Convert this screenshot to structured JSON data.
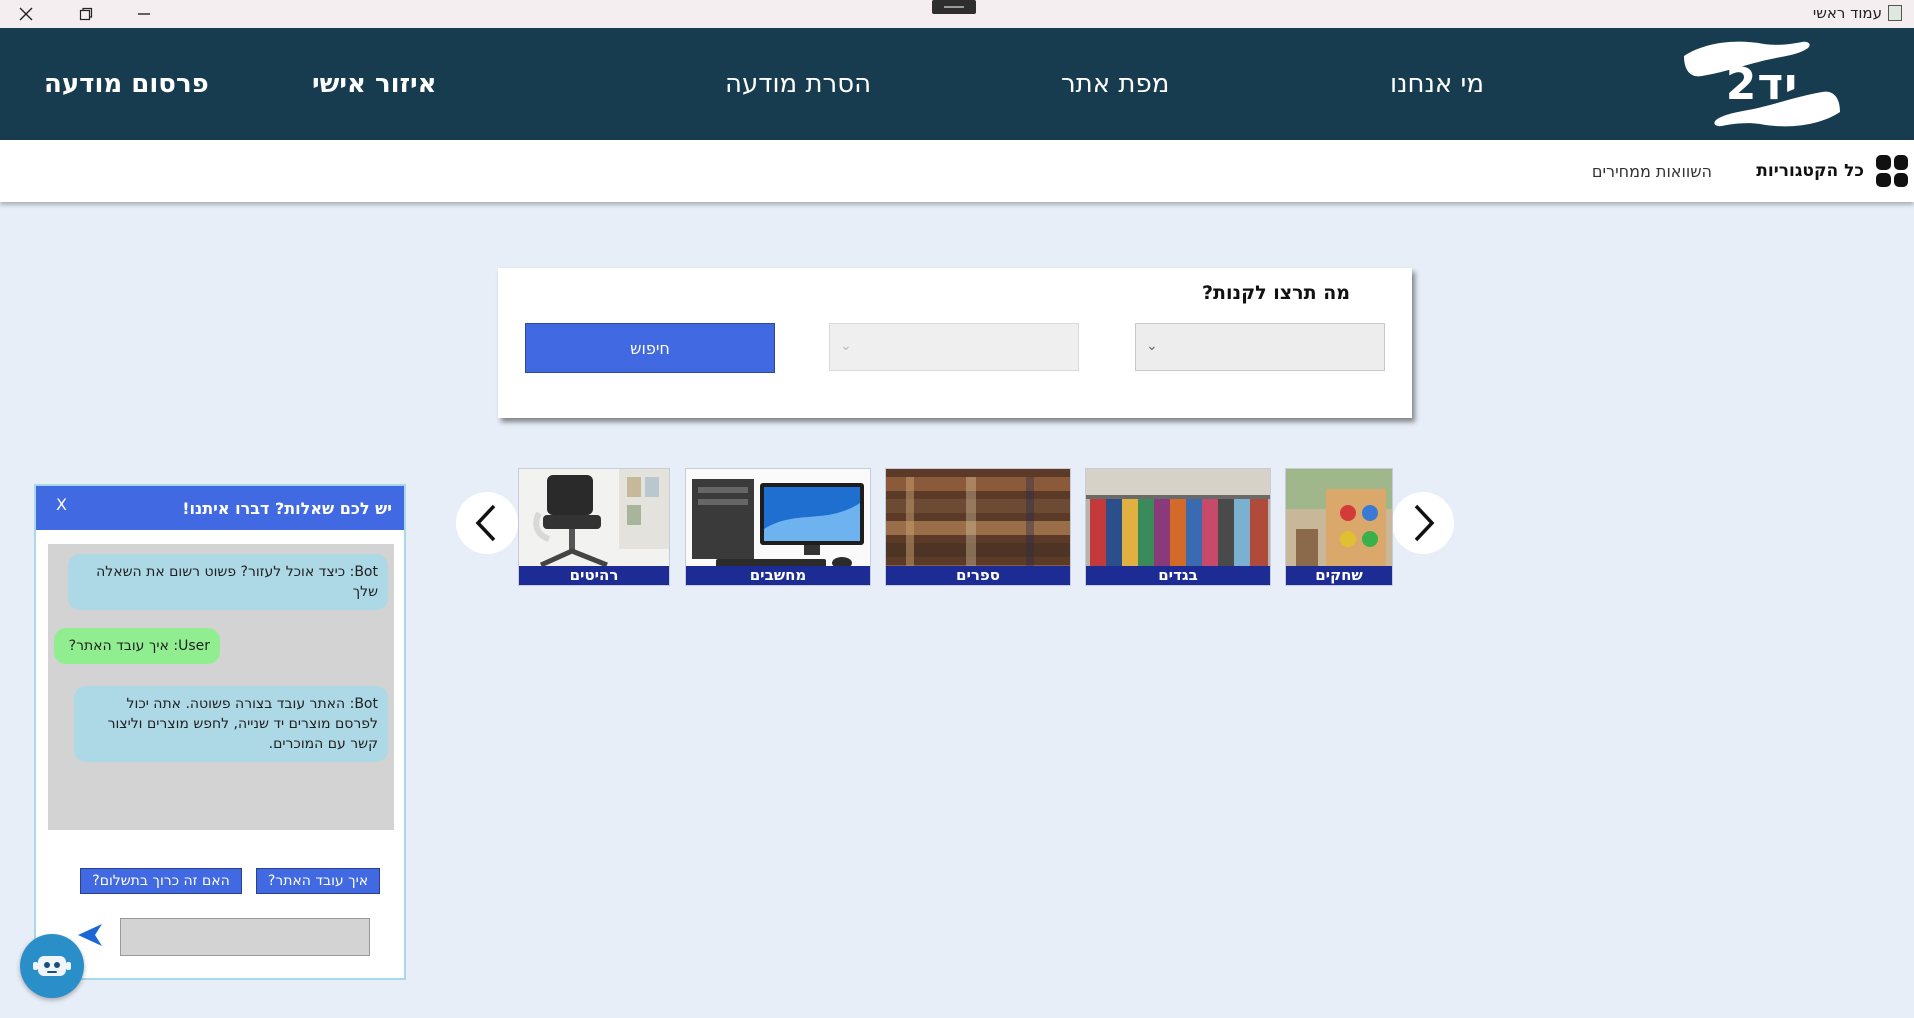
{
  "window": {
    "title": "עמוד ראשי"
  },
  "nav": {
    "logo_text": "יד2",
    "about": "מי אנחנו",
    "sitemap": "מפת אתר",
    "remove_ad": "הסרת מודעה",
    "personal_area": "איזור אישי",
    "publish_ad": "פרסום מודעה"
  },
  "subnav": {
    "all_categories": "כל הקטגוריות",
    "price_compare": "השוואות ממחירים"
  },
  "search": {
    "title": "מה תרצו לקנות?",
    "category_value": "",
    "subcategory_value": "",
    "button": "חיפוש"
  },
  "carousel": {
    "items": [
      {
        "label": "רהיטים"
      },
      {
        "label": "מחשבים"
      },
      {
        "label": "ספרים"
      },
      {
        "label": "בגדים"
      },
      {
        "label": "שחקים"
      }
    ]
  },
  "chat": {
    "title": "יש לכם שאלות? דברו איתנו!",
    "close": "X",
    "messages": [
      {
        "from": "bot",
        "text": "Bot: כיצד אוכל לעזור? פשוט רשום את השאלה שלך"
      },
      {
        "from": "user",
        "text": "User: איך עובד האתר?"
      },
      {
        "from": "bot",
        "text": "Bot: האתר עובד בצורה פשוטה. אתה יכול לפרסם מוצרים יד שנייה, לחפש מוצרים וליצור קשר עם המוכרים."
      }
    ],
    "quick_replies": [
      {
        "label": "האם זה כרוך בתשלום?"
      },
      {
        "label": "איך עובד האתר?"
      }
    ],
    "input_value": ""
  },
  "colors": {
    "nav_bg": "#173c50",
    "accent": "#4169e1",
    "card_label_bg": "#1d2b95",
    "bot_bubble": "#add8e6",
    "user_bubble": "#90ee90"
  },
  "icons": {
    "close": "close-icon",
    "restore": "restore-icon",
    "minimize": "minimize-icon",
    "categories": "grid-icon",
    "prev": "chevron-left-icon",
    "next": "chevron-right-icon",
    "send": "send-icon",
    "bot": "robot-icon"
  }
}
